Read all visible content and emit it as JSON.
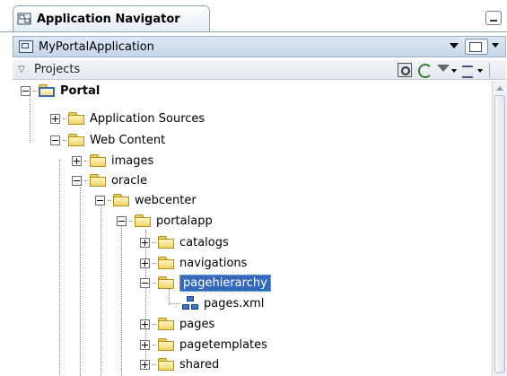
{
  "tab": {
    "title": "Application Navigator"
  },
  "app_selector": {
    "selected": "MyPortalApplication"
  },
  "projects": {
    "label": "Projects"
  },
  "tree": {
    "root": "Portal",
    "application_sources": "Application Sources",
    "web_content": "Web Content",
    "images": "images",
    "oracle": "oracle",
    "webcenter": "webcenter",
    "portalapp": "portalapp",
    "catalogs": "catalogs",
    "navigations": "navigations",
    "pagehierarchy": "pagehierarchy",
    "pages_xml": "pages.xml",
    "pages": "pages",
    "pagetemplates": "pagetemplates",
    "shared": "shared"
  },
  "colors": {
    "selection": "#3568b8",
    "folder": "#f1d56a",
    "header": "#c6d6e9"
  }
}
